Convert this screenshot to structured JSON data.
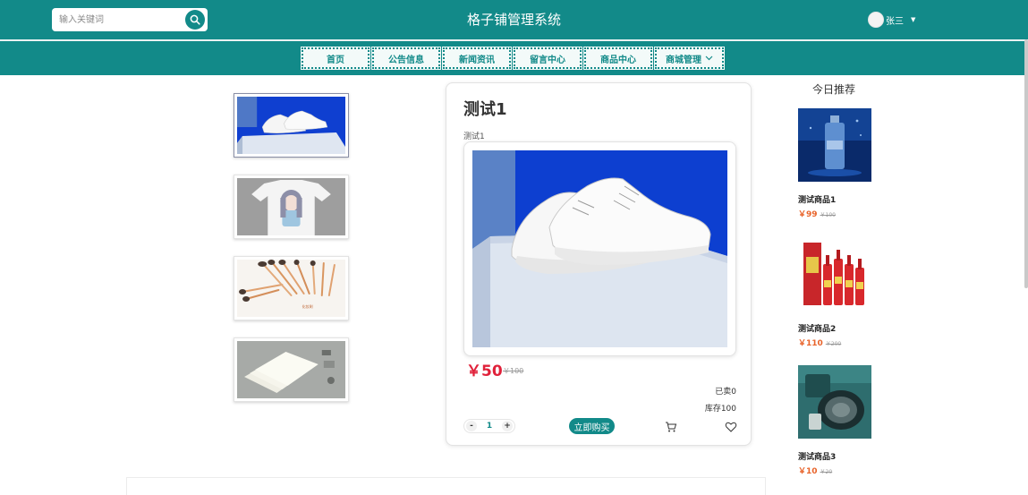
{
  "header": {
    "title": "格子铺管理系统",
    "search_placeholder": "输入关键词",
    "user_name": "张三",
    "accent_color": "#128a89"
  },
  "nav": {
    "items": [
      {
        "label": "首页"
      },
      {
        "label": "公告信息"
      },
      {
        "label": "新闻资讯"
      },
      {
        "label": "留言中心"
      },
      {
        "label": "商品中心"
      },
      {
        "label": "商城管理"
      }
    ]
  },
  "product": {
    "name": "测试1",
    "subtitle": "测试1",
    "price": "￥50",
    "old_price": "￥100",
    "sold": "已卖0",
    "stock": "库存100",
    "quantity": "1",
    "minus": "-",
    "plus": "+",
    "buy_label": "立即购买",
    "price_color": "#e0213a"
  },
  "thumbnails": [
    {
      "name": "white-sneakers"
    },
    {
      "name": "printed-tshirt"
    },
    {
      "name": "makeup-brushes"
    },
    {
      "name": "notebooks"
    }
  ],
  "recommend": {
    "title": "今日推荐",
    "items": [
      {
        "name": "测试商品1",
        "price": "￥99",
        "old_price": "￥100"
      },
      {
        "name": "测试商品2",
        "price": "￥110",
        "old_price": "￥200"
      },
      {
        "name": "测试商品3",
        "price": "￥10",
        "old_price": "￥20"
      }
    ]
  }
}
